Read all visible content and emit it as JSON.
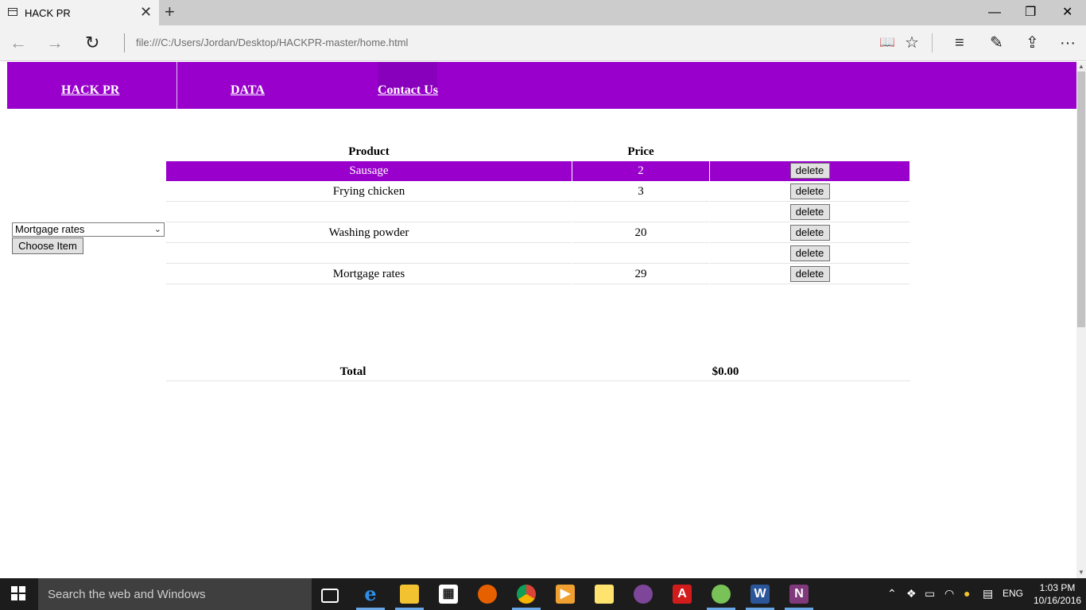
{
  "browser": {
    "tab_title": "HACK PR",
    "tab_close": "✕",
    "new_tab": "+",
    "url": "file:///C:/Users/Jordan/Desktop/HACKPR-master/home.html",
    "window_controls": {
      "minimize": "—",
      "restore": "❐",
      "close": "✕"
    },
    "nav": {
      "back": "←",
      "forward": "→",
      "refresh": "↻"
    },
    "tools": {
      "reading_view": "📖",
      "favorites": "☆",
      "hub": "≡",
      "web_note": "✎",
      "share": "⇪",
      "more": "···"
    }
  },
  "nav": {
    "items": [
      {
        "label": "HACK PR "
      },
      {
        "label": "DATA"
      },
      {
        "label": "Contact Us"
      }
    ]
  },
  "chooser": {
    "selected": "Mortgage rates",
    "button_label": "Choose Item"
  },
  "table": {
    "headers": [
      "Product",
      "Price"
    ],
    "rows": [
      {
        "product": "Sausage",
        "price": "2",
        "action": "delete"
      },
      {
        "product": "Frying chicken",
        "price": "3",
        "action": "delete"
      },
      {
        "product": "",
        "price": "",
        "action": "delete"
      },
      {
        "product": "Washing powder",
        "price": "20",
        "action": "delete"
      },
      {
        "product": "",
        "price": "",
        "action": "delete"
      },
      {
        "product": "Mortgage rates",
        "price": "29",
        "action": "delete"
      }
    ]
  },
  "total": {
    "label": "Total",
    "value": "$0.00"
  },
  "colors": {
    "accent": "#9900cc"
  },
  "taskbar": {
    "search_placeholder": "Search the web and Windows",
    "apps": [
      "task-view",
      "edge",
      "file-explorer",
      "store",
      "firefox",
      "chrome",
      "media-player",
      "photos",
      "tor",
      "acrobat",
      "android-studio",
      "word",
      "onenote"
    ],
    "tray": {
      "language": "ENG",
      "time": "1:03 PM",
      "date": "10/16/2016"
    }
  }
}
